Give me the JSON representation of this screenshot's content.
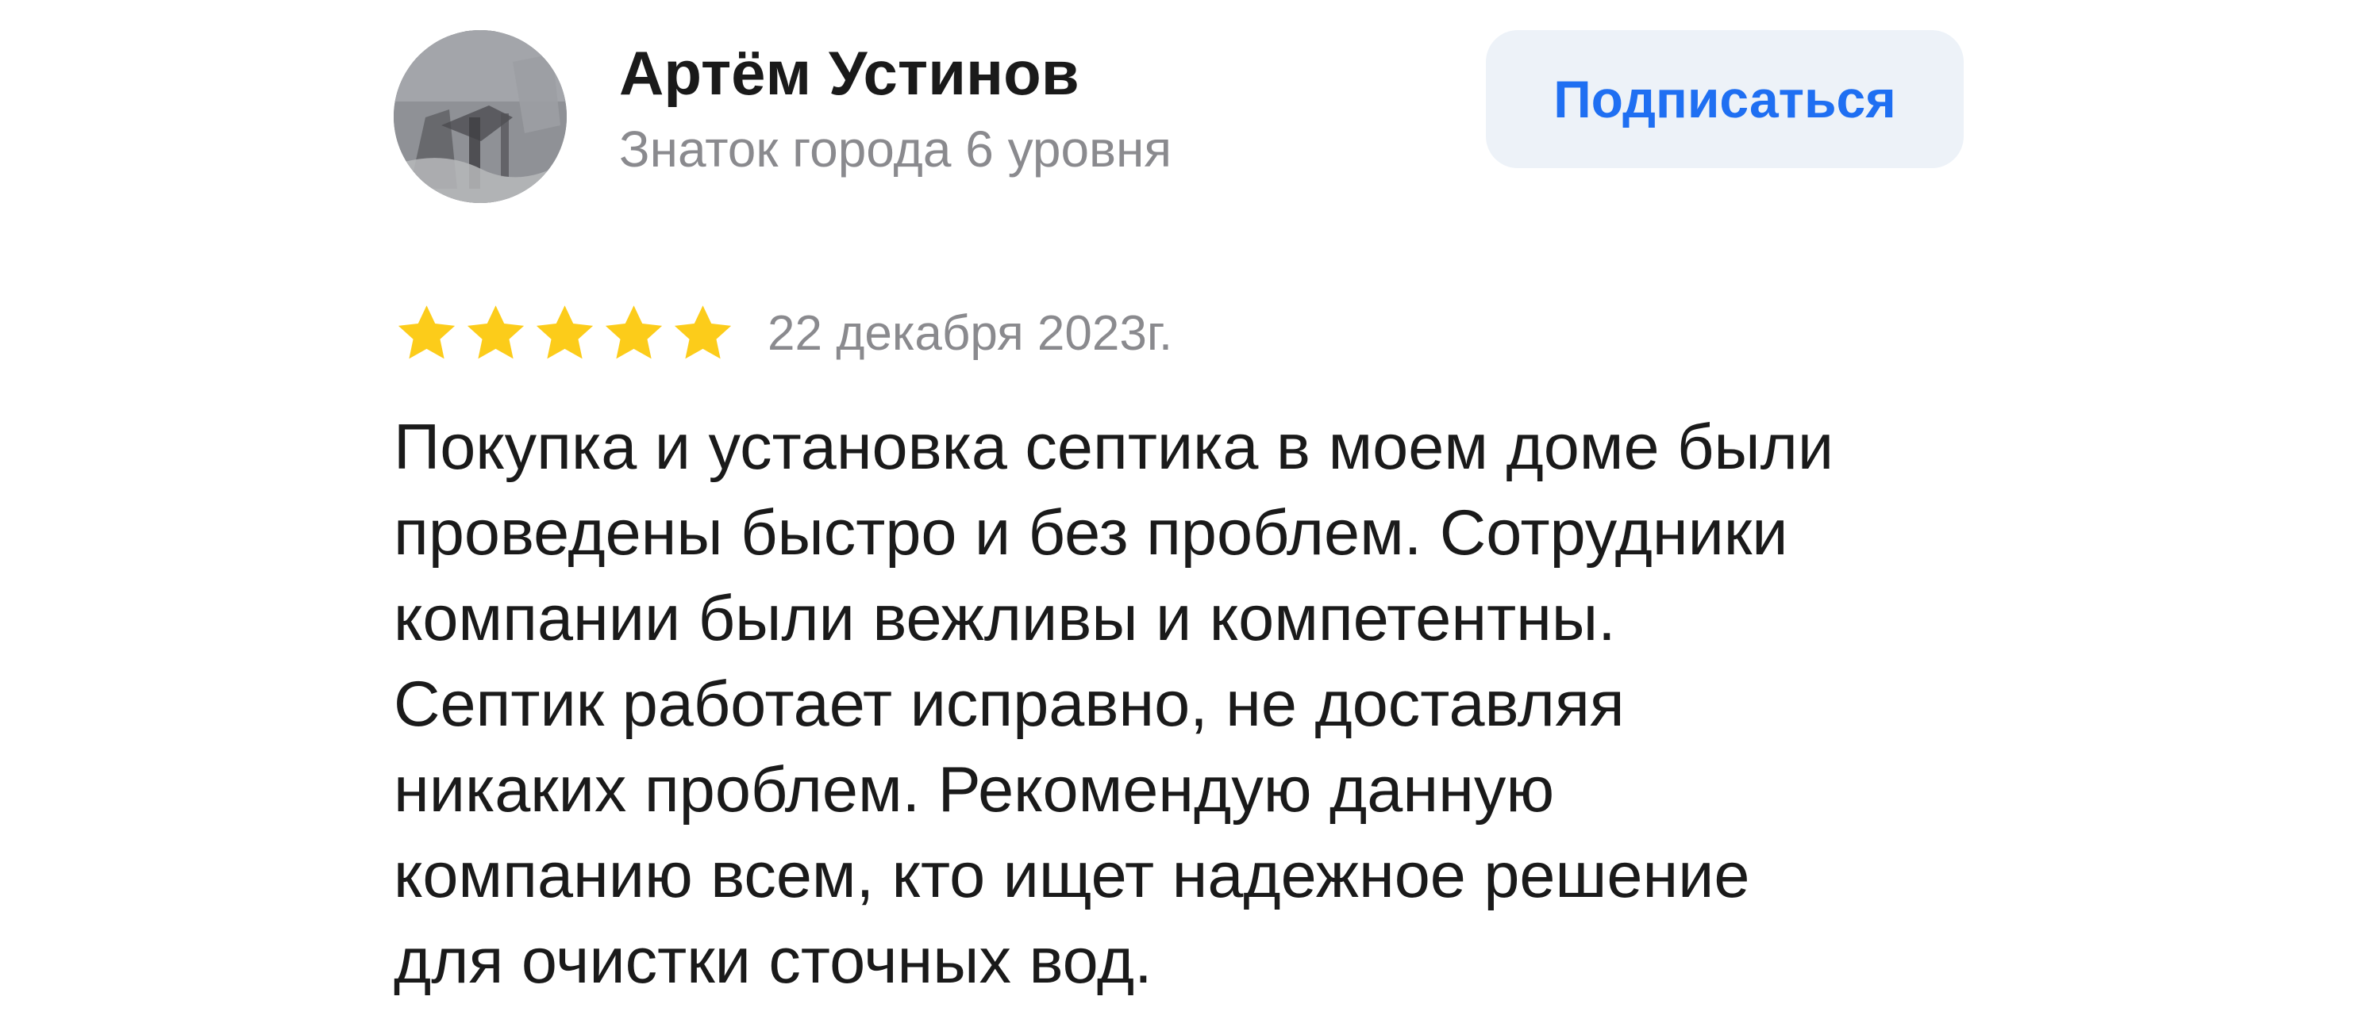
{
  "author": {
    "name": "Артём Устинов",
    "level": "Знаток города 6 уровня",
    "avatar_icon": "user-photo-avatar"
  },
  "actions": {
    "subscribe_label": "Подписаться"
  },
  "review": {
    "rating": 5,
    "max_rating": 5,
    "star_icon": "star-icon",
    "star_color": "#fccc1a",
    "date": "22 декабря 2023г.",
    "text_lines": [
      "Покупка и установка септика в моем доме были",
      "проведены быстро и без проблем. Сотрудники",
      "компании были вежливы и компетентны.",
      "Септик работает исправно, не доставляя",
      "никаких проблем. Рекомендую данную",
      "компанию всем, кто ищет надежное решение",
      "для очистки сточных вод."
    ]
  },
  "colors": {
    "accent": "#1f6ff2",
    "button_bg": "#edf2f8",
    "text_primary": "#1a1a1a",
    "text_secondary": "#8a8a8e"
  }
}
